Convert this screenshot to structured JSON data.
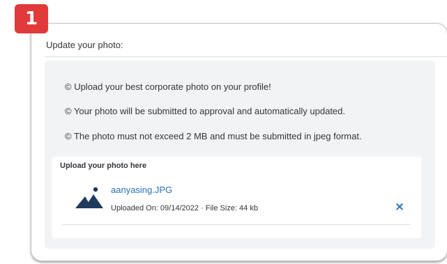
{
  "step_badge": "1",
  "card": {
    "title": "Update your photo:",
    "info_lines": [
      "© Upload your best corporate photo on your profile!",
      "© Your photo will be submitted to approval and automatically updated.",
      "© The photo must not exceed 2 MB and must be submitted in jpeg format."
    ],
    "upload": {
      "heading": "Upload your photo here",
      "file": {
        "icon": "image-icon",
        "name": "aanyasing.JPG",
        "meta": "Uploaded On: 09/14/2022 · File Size: 44 kb",
        "remove_icon": "×"
      }
    }
  },
  "colors": {
    "badge": "#e03a3a",
    "link": "#2c72b8",
    "panel": "#f2f3f4",
    "text": "#32363a"
  }
}
